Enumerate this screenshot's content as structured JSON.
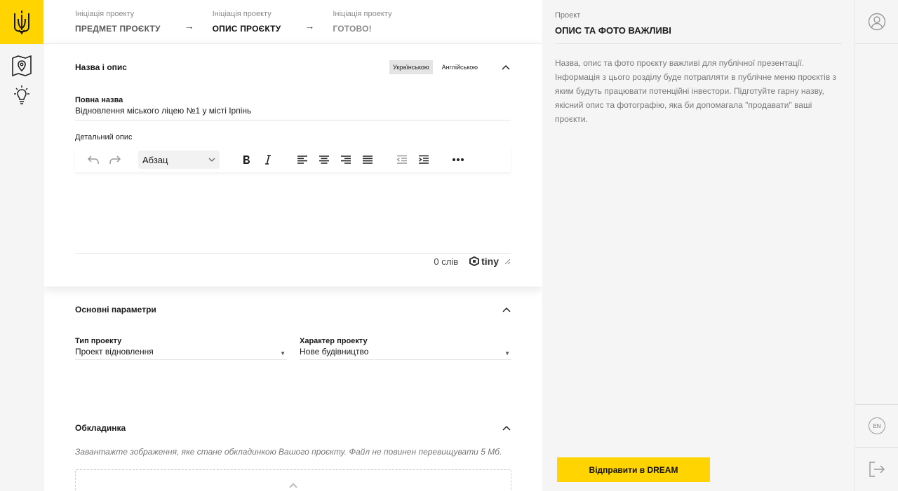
{
  "steps": [
    {
      "small": "Ініціація проекту",
      "big": "ПРЕДМЕТ ПРОЄКТУ"
    },
    {
      "small": "Ініціація проекту",
      "big": "ОПИС ПРОЄКТУ"
    },
    {
      "small": "Ініціація проекту",
      "big": "ГОТОВО!"
    }
  ],
  "arrow": "→",
  "name_section": {
    "title": "Назва і опис",
    "lang_ua": "Українською",
    "lang_en": "Англійською",
    "full_name_label": "Повна назва",
    "full_name_value": "Відновлення міського ліцею №1 у місті Ірпінь",
    "description_label": "Детальний опис",
    "format_value": "Абзац",
    "word_count": "0 слів",
    "tiny_brand": "tiny"
  },
  "params_section": {
    "title": "Основні параметри",
    "type_label": "Тип проекту",
    "type_value": "Проект відновлення",
    "nature_label": "Характер проекту",
    "nature_value": "Нове будівництво"
  },
  "cover_section": {
    "title": "Обкладинка",
    "hint": "Завантажте зображення, яке стане обкладинкою Вашого проєкту. Файл не повинен перевищувати 5 Мб."
  },
  "info_panel": {
    "small": "Проект",
    "title": "ОПИС ТА ФОТО ВАЖЛИВІ",
    "text": "Назва, опис та фото проєкту важливі для публічної презентації. Інформація з цього розділу буде потрапляти в публічне меню проєктів з яким будуть працювати потенційні інвестори. Підготуйте гарну назву, якісний опис та фотографію, яка би допомагала \"продавати\" ваші проєкти.",
    "send_button": "Відправити в DREAM"
  },
  "right_rail": {
    "lang_label": "EN"
  },
  "colors": {
    "accent": "#ffd400",
    "text": "#1a1a1a",
    "muted": "#7a7a7a"
  }
}
